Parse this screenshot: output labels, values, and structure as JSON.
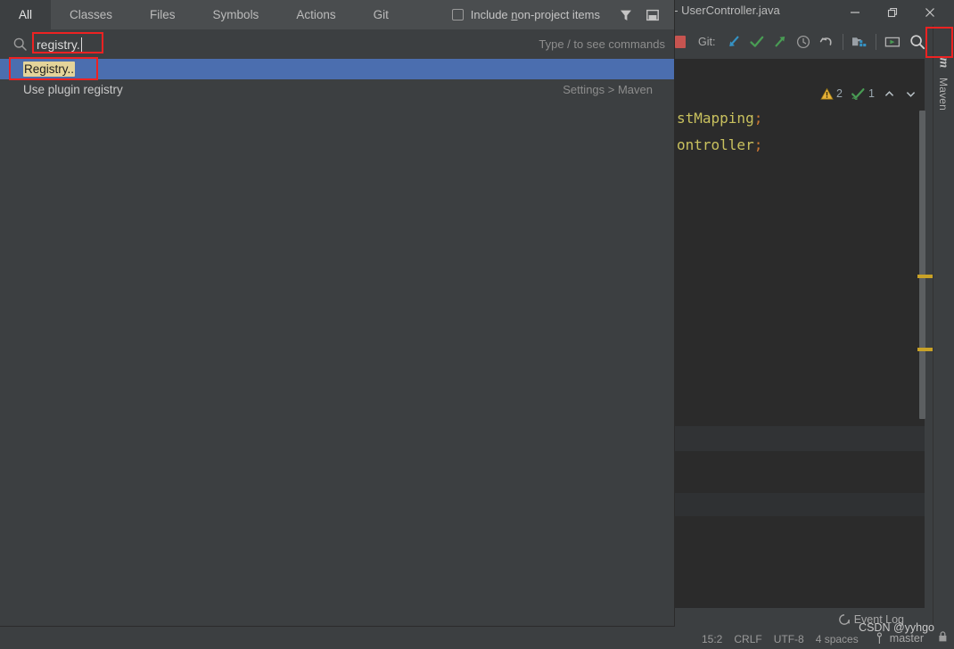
{
  "window": {
    "title": "] - UserController.java",
    "controls": {
      "minimize": "minimize-button",
      "restore": "restore-button",
      "close": "close-button"
    }
  },
  "toolbar": {
    "git_label": "Git:",
    "icons": [
      "stop-icon",
      "update-project-icon",
      "commit-icon",
      "push-icon",
      "history-icon",
      "rollback-icon",
      "project-structure-icon",
      "run-configurations-icon",
      "search-everywhere-icon"
    ]
  },
  "editor": {
    "inspections": {
      "warning_count": "2",
      "weak_warning_count": "1"
    },
    "code_lines": [
      {
        "text": "stMapping",
        "terminator": ";"
      },
      {
        "text": "ontroller",
        "terminator": ";"
      }
    ]
  },
  "right_stripe": {
    "maven_tab": {
      "icon": "m",
      "label": "Maven"
    }
  },
  "status_bar": {
    "position": "15:2",
    "line_separator": "CRLF",
    "encoding": "UTF-8",
    "indent": "4 spaces",
    "branch": "master",
    "event_log": "Event Log",
    "watermark": "CSDN @yyhgo"
  },
  "search_everywhere": {
    "tabs": [
      {
        "label": "All",
        "active": true
      },
      {
        "label": "Classes",
        "active": false
      },
      {
        "label": "Files",
        "active": false
      },
      {
        "label": "Symbols",
        "active": false
      },
      {
        "label": "Actions",
        "active": false
      },
      {
        "label": "Git",
        "active": false
      }
    ],
    "include_non_project": {
      "checked": false,
      "label_before": "Include ",
      "label_mnemonic": "n",
      "label_after": "on-project items"
    },
    "filter_icon": "filter-icon",
    "pin_icon": "pin-window-icon",
    "search": {
      "icon": "search-icon",
      "value": "registry.",
      "placeholder": "Type / to see commands",
      "hint": "Type / to see commands"
    },
    "results": [
      {
        "match_text": "Registry..",
        "rest_text": "",
        "location": "",
        "selected": true
      },
      {
        "match_text": "",
        "rest_text": "Use plugin registry",
        "location": "Settings > Maven",
        "selected": false
      }
    ]
  },
  "annotations": {
    "search_field_box": "red-highlight-search-field",
    "result_box": "red-highlight-registry-result",
    "search_icon_box": "red-highlight-search-icon"
  },
  "colors": {
    "accent_selection": "#4b6eaf",
    "match_highlight": "#e4d49a",
    "annotation": "#ee2222",
    "editor_bg": "#2b2b2b",
    "panel_bg": "#3c3f41",
    "code_text": "#c9c15e",
    "code_semicolon": "#cc7832",
    "warning": "#c9a227"
  }
}
